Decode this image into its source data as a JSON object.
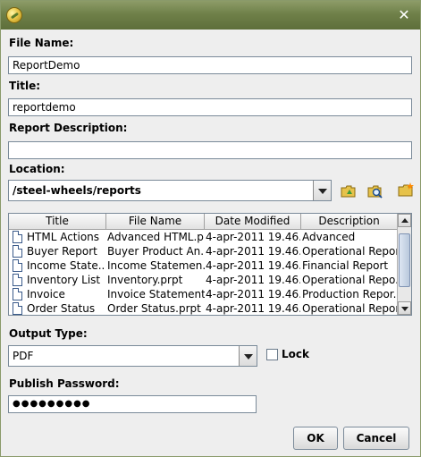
{
  "dialog": {
    "close_glyph": "✕",
    "labels": {
      "file_name": "File Name:",
      "title": "Title:",
      "report_description": "Report Description:",
      "location": "Location:",
      "output_type": "Output Type:",
      "publish_password": "Publish Password:"
    },
    "fields": {
      "file_name": "ReportDemo",
      "title": "reportdemo",
      "report_description": "",
      "location": "/steel-wheels/reports",
      "output_type": "PDF",
      "publish_password": "●●●●●●●●●"
    },
    "lock_label": "Lock",
    "table": {
      "columns": [
        "Title",
        "File Name",
        "Date Modified",
        "Description"
      ],
      "rows": [
        [
          "HTML Actions",
          "Advanced HTML.p...",
          "4-apr-2011 19.46....",
          "Advanced"
        ],
        [
          "Buyer Report",
          "Buyer Product An...",
          "4-apr-2011 19.46....",
          "Operational Report"
        ],
        [
          "Income State...",
          "Income Statemen...",
          "4-apr-2011 19.46....",
          "Financial Report"
        ],
        [
          "Inventory List",
          "Inventory.prpt",
          "4-apr-2011 19.46....",
          "Operational Repo..."
        ],
        [
          "Invoice",
          "Invoice Statement...",
          "4-apr-2011 19.46....",
          "Production Repor..."
        ],
        [
          "Order Status",
          "Order Status.prpt",
          "4-apr-2011 19.46....",
          "Operational Report"
        ]
      ]
    },
    "buttons": {
      "ok": "OK",
      "cancel": "Cancel"
    },
    "icons": [
      "app-icon",
      "close-icon",
      "upload-folder-icon",
      "browse-search-icon",
      "new-folder-icon",
      "document-icon",
      "dropdown-arrow-icon"
    ],
    "colors": {
      "titlebar": "#6f8049",
      "dialog_bg": "#eeeeee"
    }
  }
}
